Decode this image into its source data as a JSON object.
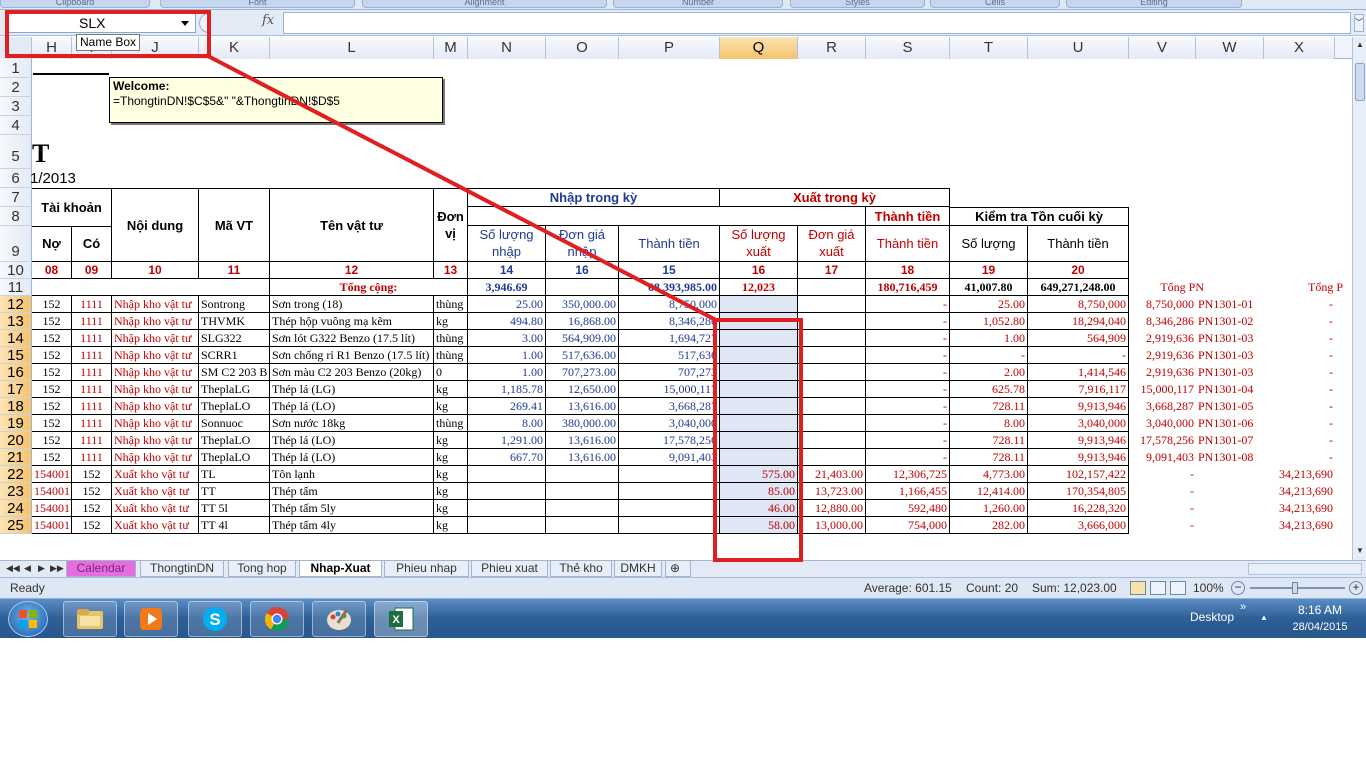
{
  "ribbon": {
    "groups": [
      "Clipboard",
      "Font",
      "Alignment",
      "Number",
      "Styles",
      "Cells",
      "Editing"
    ]
  },
  "formula_bar": {
    "name_box": "SLX",
    "fx_label": "fx",
    "formula": "",
    "tooltip": "Name Box"
  },
  "columns": [
    "H",
    "I",
    "J",
    "K",
    "L",
    "M",
    "N",
    "O",
    "P",
    "Q",
    "R",
    "S",
    "T",
    "U",
    "V",
    "W",
    "X"
  ],
  "selected_column": "Q",
  "rows": [
    "1",
    "2",
    "3",
    "4",
    "5",
    "6",
    "7",
    "8",
    "9",
    "10",
    "11",
    "12",
    "13",
    "14",
    "15",
    "16",
    "17",
    "18",
    "19",
    "20",
    "21",
    "22",
    "23",
    "24",
    "25"
  ],
  "comment": {
    "title": "Welcome:",
    "text": "=ThongtinDN!$C$5&\" \"&ThongtinDN!$D$5"
  },
  "title_fragment": "T",
  "date_fragment": "1/2013",
  "headers": {
    "tai_khoan": "Tài khoản",
    "no": "Nợ",
    "co": "Có",
    "noi_dung": "Nội dung",
    "ma_vt": "Mã VT",
    "ten_vat_tu": "Tên vật tư",
    "don_vi": "Đơn vị",
    "nhap_trong_ky": "Nhập trong kỳ",
    "xuat_trong_ky": "Xuất trong kỳ",
    "sl_nhap": "Số lượng nhập",
    "dg_nhap": "Đơn giá nhập",
    "thanh_tien": "Thành tiền",
    "sl_xuat": "Số lượng xuất",
    "dg_xuat": "Đơn giá xuất",
    "thanh_tien_xuat": "Thành tiền",
    "kiem_tra": "Kiểm tra Tồn cuối kỳ",
    "so_luong": "Số lượng",
    "thanh_tien_ton": "Thành tiền"
  },
  "col_numbers": [
    "08",
    "09",
    "10",
    "11",
    "12",
    "13",
    "14",
    "16",
    "15",
    "16",
    "17",
    "18",
    "19",
    "20"
  ],
  "totals": {
    "label": "Tổng cộng:",
    "sl_nhap": "3,946.69",
    "thanh_tien": "68,393,985.00",
    "sl_xuat": "12,023",
    "thanh_tien_xuat": "180,716,459",
    "ton_sl": "41,007.80",
    "ton_tt": "649,271,248.00",
    "tong_pn": "Tổng PN",
    "tong_p": "Tổng P"
  },
  "data_rows": [
    {
      "no": "152",
      "co": "1111",
      "nd": "Nhập kho vật tư",
      "ma": "Sontrong",
      "ten": "Sơn trong (18)",
      "dv": "thùng",
      "sln": "25.00",
      "dgn": "350,000.00",
      "ttn": "8,750,000",
      "slx": "",
      "dgx": "",
      "ttx": "-",
      "tsl": "25.00",
      "ttt": "8,750,000",
      "v": "8,750,000",
      "w": "PN1301-01",
      "x": "-"
    },
    {
      "no": "152",
      "co": "1111",
      "nd": "Nhập kho vật tư",
      "ma": "THVMK",
      "ten": "Thép hộp vuông mạ kẽm",
      "dv": "kg",
      "sln": "494.80",
      "dgn": "16,868.00",
      "ttn": "8,346,286",
      "slx": "",
      "dgx": "",
      "ttx": "-",
      "tsl": "1,052.80",
      "ttt": "18,294,040",
      "v": "8,346,286",
      "w": "PN1301-02",
      "x": "-"
    },
    {
      "no": "152",
      "co": "1111",
      "nd": "Nhập kho vật tư",
      "ma": "SLG322",
      "ten": "Sơn lót G322 Benzo (17.5 lít)",
      "dv": "thùng",
      "sln": "3.00",
      "dgn": "564,909.00",
      "ttn": "1,694,727",
      "slx": "",
      "dgx": "",
      "ttx": "-",
      "tsl": "1.00",
      "ttt": "564,909",
      "v": "2,919,636",
      "w": "PN1301-03",
      "x": "-"
    },
    {
      "no": "152",
      "co": "1111",
      "nd": "Nhập kho vật tư",
      "ma": "SCRR1",
      "ten": "Sơn chống rỉ R1 Benzo (17.5 lít)",
      "dv": "thùng",
      "sln": "1.00",
      "dgn": "517,636.00",
      "ttn": "517,636",
      "slx": "",
      "dgx": "",
      "ttx": "-",
      "tsl": "-",
      "ttt": "-",
      "v": "2,919,636",
      "w": "PN1301-03",
      "x": "-"
    },
    {
      "no": "152",
      "co": "1111",
      "nd": "Nhập kho vật tư",
      "ma": "SM C2 203 B",
      "ten": "Sơn màu C2 203 Benzo (20kg)",
      "dv": "0",
      "sln": "1.00",
      "dgn": "707,273.00",
      "ttn": "707,273",
      "slx": "",
      "dgx": "",
      "ttx": "-",
      "tsl": "2.00",
      "ttt": "1,414,546",
      "v": "2,919,636",
      "w": "PN1301-03",
      "x": "-"
    },
    {
      "no": "152",
      "co": "1111",
      "nd": "Nhập kho vật tư",
      "ma": "TheplaLG",
      "ten": "Thép lá (LG)",
      "dv": "kg",
      "sln": "1,185.78",
      "dgn": "12,650.00",
      "ttn": "15,000,117",
      "slx": "",
      "dgx": "",
      "ttx": "-",
      "tsl": "625.78",
      "ttt": "7,916,117",
      "v": "15,000,117",
      "w": "PN1301-04",
      "x": "-"
    },
    {
      "no": "152",
      "co": "1111",
      "nd": "Nhập kho vật tư",
      "ma": "TheplaLO",
      "ten": "Thép lá (LO)",
      "dv": "kg",
      "sln": "269.41",
      "dgn": "13,616.00",
      "ttn": "3,668,287",
      "slx": "",
      "dgx": "",
      "ttx": "-",
      "tsl": "728.11",
      "ttt": "9,913,946",
      "v": "3,668,287",
      "w": "PN1301-05",
      "x": "-"
    },
    {
      "no": "152",
      "co": "1111",
      "nd": "Nhập kho vật tư",
      "ma": "Sonnuoc",
      "ten": "Sơn nước 18kg",
      "dv": "thùng",
      "sln": "8.00",
      "dgn": "380,000.00",
      "ttn": "3,040,000",
      "slx": "",
      "dgx": "",
      "ttx": "-",
      "tsl": "8.00",
      "ttt": "3,040,000",
      "v": "3,040,000",
      "w": "PN1301-06",
      "x": "-"
    },
    {
      "no": "152",
      "co": "1111",
      "nd": "Nhập kho vật tư",
      "ma": "TheplaLO",
      "ten": "Thép lá (LO)",
      "dv": "kg",
      "sln": "1,291.00",
      "dgn": "13,616.00",
      "ttn": "17,578,256",
      "slx": "",
      "dgx": "",
      "ttx": "-",
      "tsl": "728.11",
      "ttt": "9,913,946",
      "v": "17,578,256",
      "w": "PN1301-07",
      "x": "-"
    },
    {
      "no": "152",
      "co": "1111",
      "nd": "Nhập kho vật tư",
      "ma": "TheplaLO",
      "ten": "Thép lá (LO)",
      "dv": "kg",
      "sln": "667.70",
      "dgn": "13,616.00",
      "ttn": "9,091,403",
      "slx": "",
      "dgx": "",
      "ttx": "-",
      "tsl": "728.11",
      "ttt": "9,913,946",
      "v": "9,091,403",
      "w": "PN1301-08",
      "x": "-"
    },
    {
      "no": "154001",
      "co": "152",
      "nd": "Xuất kho vật tư",
      "ma": "TL",
      "ten": "Tôn lạnh",
      "dv": "kg",
      "sln": "",
      "dgn": "",
      "ttn": "",
      "slx": "575.00",
      "dgx": "21,403.00",
      "ttx": "12,306,725",
      "tsl": "4,773.00",
      "ttt": "102,157,422",
      "v": "-",
      "w": "",
      "x": "34,213,690"
    },
    {
      "no": "154001",
      "co": "152",
      "nd": "Xuất kho vật tư",
      "ma": "TT",
      "ten": "Thép tấm",
      "dv": "kg",
      "sln": "",
      "dgn": "",
      "ttn": "",
      "slx": "85.00",
      "dgx": "13,723.00",
      "ttx": "1,166,455",
      "tsl": "12,414.00",
      "ttt": "170,354,805",
      "v": "-",
      "w": "",
      "x": "34,213,690"
    },
    {
      "no": "154001",
      "co": "152",
      "nd": "Xuất kho vật tư",
      "ma": "TT 5l",
      "ten": "Thép tấm 5ly",
      "dv": "kg",
      "sln": "",
      "dgn": "",
      "ttn": "",
      "slx": "46.00",
      "dgx": "12,880.00",
      "ttx": "592,480",
      "tsl": "1,260.00",
      "ttt": "16,228,320",
      "v": "-",
      "w": "",
      "x": "34,213,690"
    },
    {
      "no": "154001",
      "co": "152",
      "nd": "Xuất kho vật tư",
      "ma": "TT 4l",
      "ten": "Thép tấm 4ly",
      "dv": "kg",
      "sln": "",
      "dgn": "",
      "ttn": "",
      "slx": "58.00",
      "dgx": "13,000.00",
      "ttx": "754,000",
      "tsl": "282.00",
      "ttt": "3,666,000",
      "v": "-",
      "w": "",
      "x": "34,213,690"
    }
  ],
  "sheet_tabs": [
    "Calendar",
    "ThongtinDN",
    "Tong hop",
    "Nhap-Xuat",
    "Phieu nhap",
    "Phieu xuat",
    "Thẻ kho",
    "DMKH"
  ],
  "active_tab": "Nhap-Xuat",
  "status": {
    "ready": "Ready",
    "average": "Average:  601.15",
    "count": "Count: 20",
    "sum": "Sum:  12,023.00",
    "zoom": "100%"
  },
  "taskbar": {
    "desktop_label": "Desktop",
    "time": "8:16 AM",
    "date": "28/04/2015",
    "apps": [
      "start-orb",
      "file-explorer",
      "media-player",
      "skype",
      "chrome",
      "paint",
      "excel"
    ]
  },
  "colors": {
    "annotation_red": "#e02020",
    "header_blue": "#1f3b93",
    "text_red": "#c00000",
    "selection_fill": "#dfe6f4"
  }
}
